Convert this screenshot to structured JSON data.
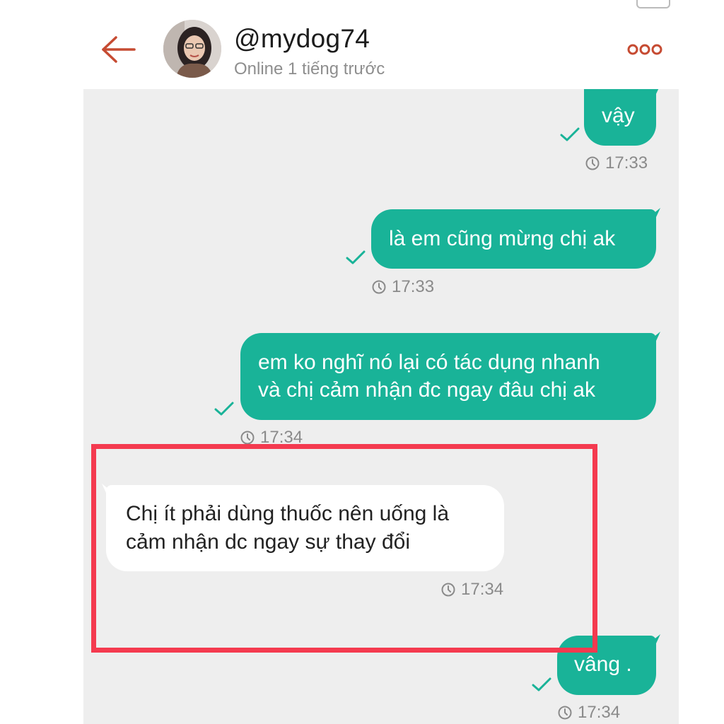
{
  "header": {
    "username": "@mydog74",
    "status": "Online 1 tiếng trước"
  },
  "messages": [
    {
      "direction": "out",
      "text": "vậy",
      "time": "17:33",
      "read": true
    },
    {
      "direction": "out",
      "text": "là em cũng mừng chị ak",
      "time": "17:33",
      "read": true
    },
    {
      "direction": "out",
      "lines": [
        "em ko nghĩ nó lại có tác dụng nhanh",
        "và chị cảm nhận đc ngay đâu chị ak"
      ],
      "time": "17:34",
      "read": true
    },
    {
      "direction": "in",
      "lines": [
        "Chị ít phải dùng thuốc nên uống là",
        "cảm nhận dc ngay sự thay đổi"
      ],
      "time": "17:34"
    },
    {
      "direction": "out",
      "text": "vâng .",
      "time": "17:34",
      "read": true
    }
  ],
  "colors": {
    "accent": "#c64b32",
    "outgoing_bubble": "#19b398",
    "highlight": "#f43a4f",
    "chat_background": "#eeeeee"
  },
  "icons": {
    "back": "arrow-left-icon",
    "more": "more-dots-icon",
    "read": "check-icon",
    "time": "clock-icon"
  }
}
